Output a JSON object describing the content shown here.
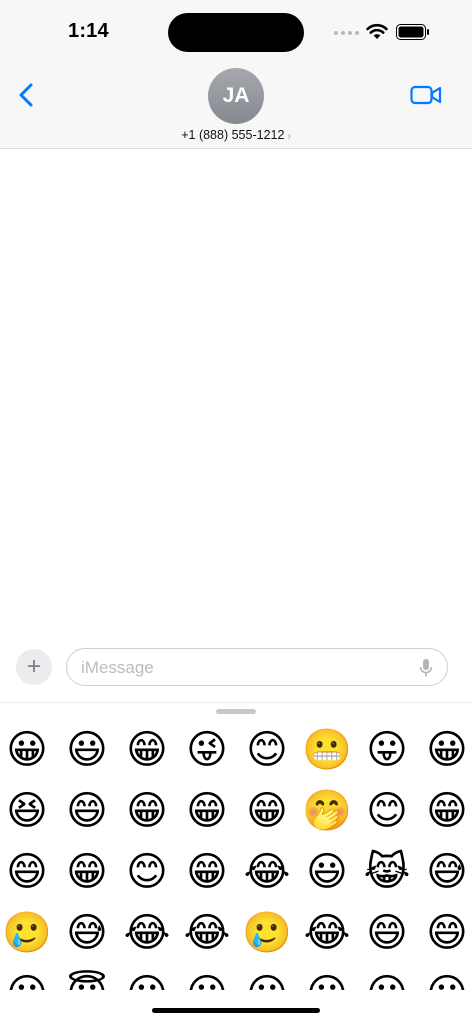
{
  "status": {
    "time": "1:14"
  },
  "header": {
    "avatar_initials": "JA",
    "contact": "+1 (888) 555-1212",
    "contact_chevron": "›",
    "accent_color": "#007aff"
  },
  "compose": {
    "placeholder": "iMessage",
    "plus_symbol": "+"
  },
  "keyboard": {
    "rows": [
      [
        "😀",
        "😃",
        "😁",
        "😜",
        "😊",
        "😬",
        "😛",
        "😀"
      ],
      [
        "😆",
        "😄",
        "😁",
        "😁",
        "😁",
        "🤭",
        "😊",
        "😁"
      ],
      [
        "😄",
        "😁",
        "😊",
        "😁",
        "😂",
        "😃",
        "😹",
        "😅"
      ],
      [
        "🥲",
        "😅",
        "😂",
        "😂",
        "🥲",
        "😂",
        "😄",
        "😄"
      ],
      [
        "😀",
        "😇",
        "😀",
        "😀",
        "😀",
        "😀",
        "😀",
        "😀"
      ]
    ]
  }
}
